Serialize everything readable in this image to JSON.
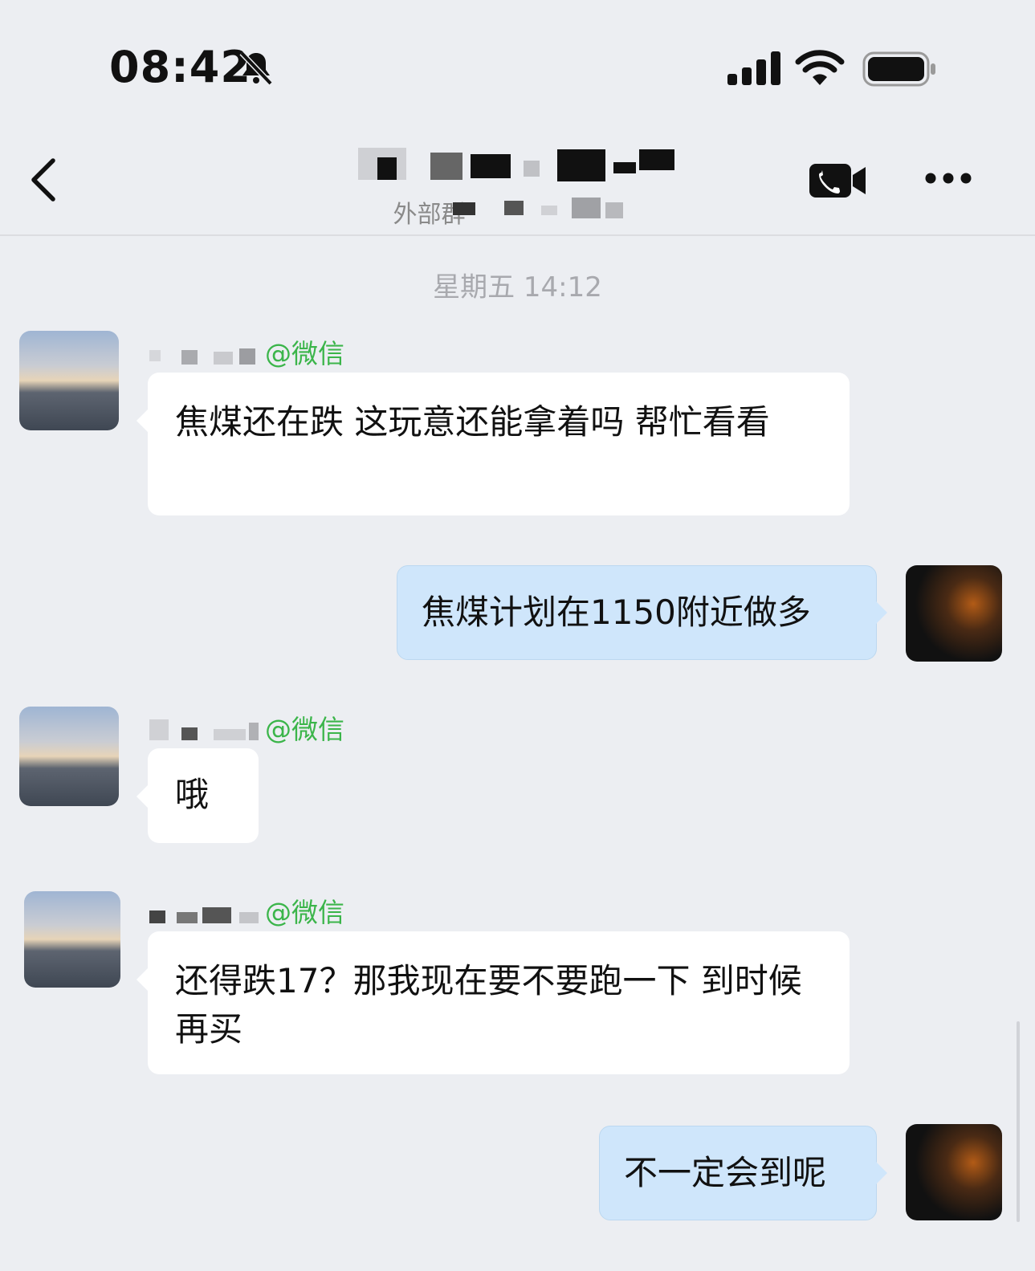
{
  "status_bar": {
    "time": "08:42"
  },
  "header": {
    "title": "",
    "subtitle": "外部群"
  },
  "timestamp": "星期五 14:12",
  "messages": [
    {
      "direction": "in",
      "sender_suffix": "@微信",
      "text": "焦煤还在跌 这玩意还能拿着吗  帮忙看看"
    },
    {
      "direction": "out",
      "text": "焦煤计划在1150附近做多"
    },
    {
      "direction": "in",
      "sender_suffix": "@微信",
      "text": "哦"
    },
    {
      "direction": "in",
      "sender_suffix": "@微信",
      "text": "还得跌17？那我现在要不要跑一下  到时候再买"
    },
    {
      "direction": "out",
      "text": "不一定会到呢"
    }
  ],
  "colors": {
    "background": "#eceef2",
    "bubble_out": "#cfe6fb",
    "bubble_in": "#ffffff",
    "wechat_green": "#3bb54a"
  }
}
